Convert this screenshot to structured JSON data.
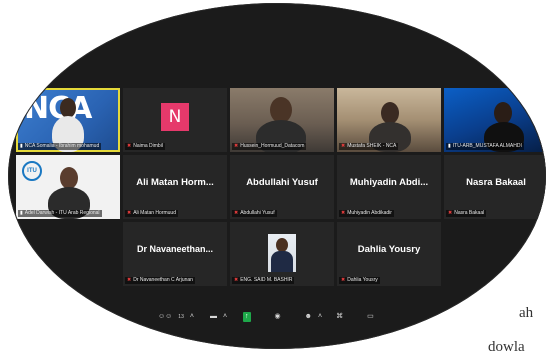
{
  "meeting": {
    "participant_count": "13",
    "tiles": [
      {
        "type": "video",
        "variant": "nca",
        "display_text": "NCA",
        "nameplate": "NCA Somalia - Ibrahim mohamud",
        "muted": false,
        "active": true
      },
      {
        "type": "avatar",
        "avatar_letter": "N",
        "nameplate": "Naima Dimbil",
        "muted": true
      },
      {
        "type": "video",
        "variant": "room",
        "nameplate": "Hussein_Hormuud_Datacom",
        "muted": true
      },
      {
        "type": "video",
        "variant": "office",
        "nameplate": "Mustafa SHEIK - NCA",
        "muted": true
      },
      {
        "type": "video",
        "variant": "blue",
        "nameplate": "ITU-ARB_MUSTAFA ALMAHDI",
        "muted": false
      },
      {
        "type": "video",
        "variant": "itu",
        "display_text": "ITU",
        "nameplate": "Adel Darwish - ITU Arab Regional",
        "muted": false
      },
      {
        "type": "name",
        "big_name": "Ali Matan Horm...",
        "nameplate": "Ali Matan Hormuud",
        "muted": true
      },
      {
        "type": "name",
        "big_name": "Abdullahi Yusuf",
        "nameplate": "Abdullahi Yusuf",
        "muted": true
      },
      {
        "type": "name",
        "big_name": "Muhiyadin Abdi...",
        "nameplate": "Muhiyadin Abdikadir",
        "muted": true
      },
      {
        "type": "name",
        "big_name": "Nasra Bakaal",
        "nameplate": "Nasra Bakaal",
        "muted": true
      },
      {
        "type": "empty"
      },
      {
        "type": "name",
        "big_name": "Dr Navaneethan...",
        "nameplate": "Dr Navaneethan C Arjunan",
        "muted": true
      },
      {
        "type": "photo",
        "nameplate": "ENG. SAID M. BASHIR",
        "muted": true
      },
      {
        "type": "name",
        "big_name": "Dahlia Yousry",
        "nameplate": "Dahlia Yousry",
        "muted": true
      },
      {
        "type": "empty"
      }
    ]
  },
  "overflow_text": {
    "line1": "ah",
    "line2": "dowla"
  },
  "colors": {
    "active_speaker": "#e5d93a",
    "muted_mic": "#e23b3b",
    "avatar_bg": "#e6396b",
    "share_button": "#1ea84a"
  },
  "icons": {
    "muted": "mic-off-icon",
    "unmuted": "mic-icon"
  }
}
